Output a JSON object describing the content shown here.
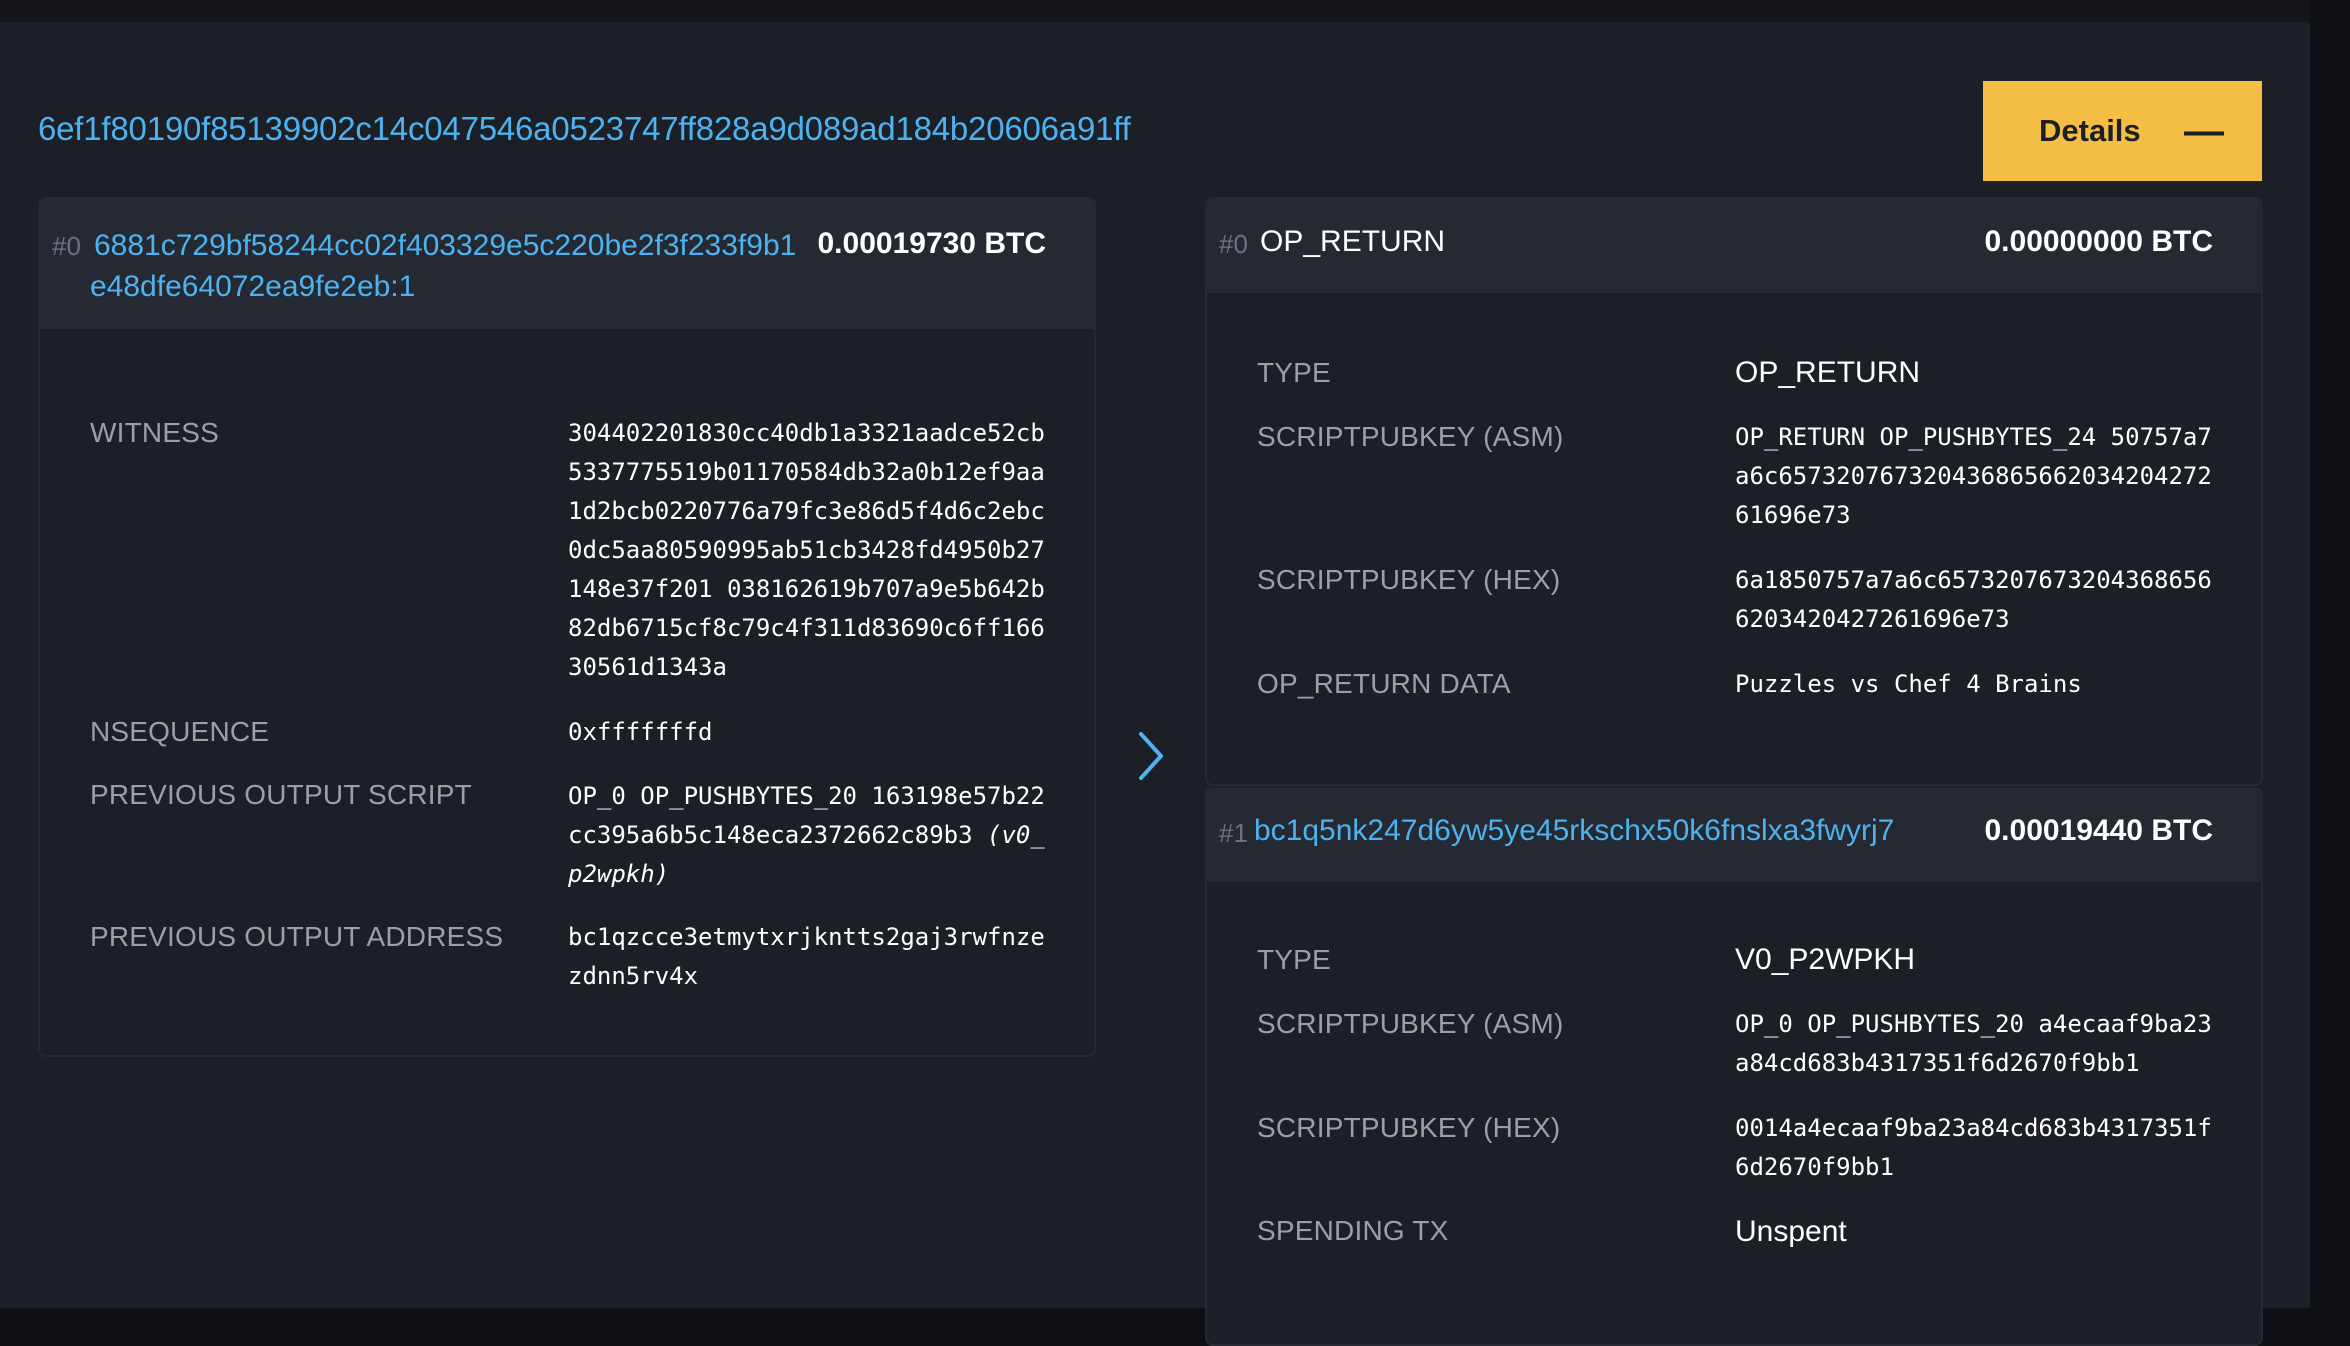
{
  "transaction": {
    "txid": "6ef1f80190f85139902c14c047546a0523747ff828a9d089ad184b20606a91ff",
    "details_button_label": "Details",
    "details_toggle_icon": "minus-icon"
  },
  "inputs": [
    {
      "index": "#0",
      "prev_txid_line1": "6881c729bf58244cc02f403329e5c220be2f3f233f9b1",
      "prev_txid_line2": "e48dfe64072ea9fe2eb:1",
      "amount": "0.00019730 BTC",
      "witness_label": "WITNESS",
      "witness_value": "304402201830cc40db1a3321aadce52cb5337775519b01170584db32a0b12ef9aa1d2bcb0220776a79fc3e86d5f4d6c2ebc0dc5aa80590995ab51cb3428fd4950b27148e37f201 038162619b707a9e5b642b82db6715cf8c79c4f311d83690c6ff16630561d1343a",
      "nsequence_label": "NSEQUENCE",
      "nsequence_value": "0xfffffffd",
      "prev_script_label": "PREVIOUS OUTPUT SCRIPT",
      "prev_script_value": "OP_0 OP_PUSHBYTES_20 163198e57b22cc395a6b5c148eca2372662c89b3",
      "prev_script_type": "(v0_p2wpkh)",
      "prev_address_label": "PREVIOUS OUTPUT ADDRESS",
      "prev_address_value": "bc1qzcce3etmytxrjkntts2gaj3rwfnzezdnn5rv4x"
    }
  ],
  "outputs": [
    {
      "index": "#0",
      "title": "OP_RETURN",
      "amount": "0.00000000 BTC",
      "type_label": "TYPE",
      "type_value": "OP_RETURN",
      "asm_label": "SCRIPTPUBKEY (ASM)",
      "asm_value": "OP_RETURN OP_PUSHBYTES_24 50757a7a6c65732076732043686566203420427261696e73",
      "hex_label": "SCRIPTPUBKEY (HEX)",
      "hex_value": "6a1850757a7a6c65732076732043686566203420427261696e73",
      "data_label": "OP_RETURN DATA",
      "data_value": "Puzzles vs Chef 4 Brains"
    },
    {
      "index": "#1",
      "title": "bc1q5nk247d6yw5ye45rkschx50k6fnslxa3fwyrj7",
      "amount": "0.00019440 BTC",
      "type_label": "TYPE",
      "type_value": "V0_P2WPKH",
      "asm_label": "SCRIPTPUBKEY (ASM)",
      "asm_value": "OP_0 OP_PUSHBYTES_20 a4ecaaf9ba23a84cd683b4317351f6d2670f9bb1",
      "hex_label": "SCRIPTPUBKEY (HEX)",
      "hex_value": "0014a4ecaaf9ba23a84cd683b4317351f6d2670f9bb1",
      "spending_label": "SPENDING TX",
      "spending_value": "Unspent"
    }
  ],
  "flow_arrow_icon": "chevron-right-icon",
  "colors": {
    "background": "#1c1f26",
    "header_bg": "#252931",
    "accent_link": "#4db3f0",
    "button": "#f4bd43",
    "label": "#9aa0ab"
  }
}
